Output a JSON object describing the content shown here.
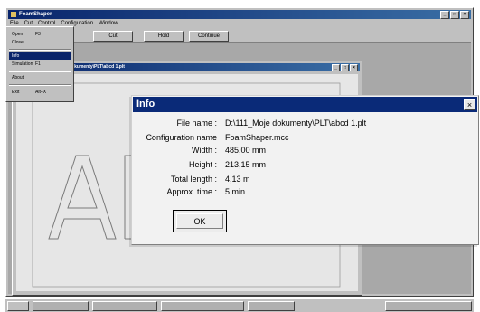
{
  "app": {
    "title": "FoamShaper",
    "menus": [
      "File",
      "Cut",
      "Control",
      "Configuration",
      "Window"
    ],
    "toolbar": [
      "Cut",
      "Hold",
      "Continue"
    ]
  },
  "file_menu": {
    "items": [
      {
        "label": "Open",
        "shortcut": "F3"
      },
      {
        "label": "Close",
        "shortcut": ""
      },
      {
        "label": "Info",
        "shortcut": ""
      },
      {
        "label": "Simulation",
        "shortcut": "F1"
      },
      {
        "label": "About",
        "shortcut": ""
      },
      {
        "label": "Exit",
        "shortcut": "Alt+X"
      }
    ]
  },
  "child_window": {
    "title": "dokumenty\\PLT\\abcd 1.plt"
  },
  "info_dialog": {
    "title": "Info",
    "rows": [
      {
        "label": "File name :",
        "value": "D:\\111_Moje dokumenty\\PLT\\abcd 1.plt"
      },
      {
        "label": "Configuration name",
        "value": "FoamShaper.mcc"
      },
      {
        "label": "Width :",
        "value": "485,00 mm"
      },
      {
        "label": "Height :",
        "value": "213,15 mm"
      },
      {
        "label": "Total length :",
        "value": "4,13 m"
      },
      {
        "label": "Approx. time :",
        "value": "5 min"
      }
    ],
    "ok_label": "OK"
  },
  "colors": {
    "title_bar": "#0a2a78",
    "face": "#c0c0c0",
    "dialog_bg": "#f2f2f2"
  }
}
